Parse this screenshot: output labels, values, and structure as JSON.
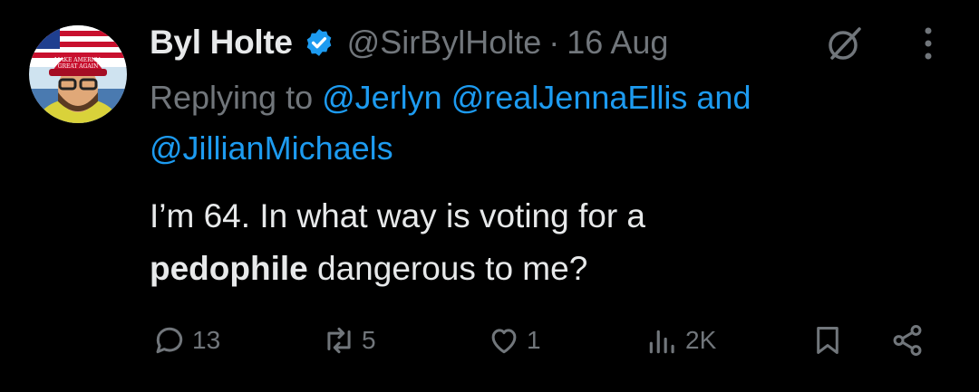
{
  "tweet": {
    "display_name": "Byl Holte",
    "handle": "@SirBylHolte",
    "separator": "·",
    "date": "16 Aug",
    "reply_prefix": "Replying to",
    "mentions": [
      "@Jerlyn",
      "@realJennaEllis",
      "@JillianMichaels"
    ],
    "mention_joiner": "and",
    "text_line1": "I’m 64. In what way is voting for a",
    "text_bold": "pedophile",
    "text_rest": "dangerous to me?",
    "avatar_hat_text": "MAKE AMERICA GREAT AGAIN"
  },
  "actions": {
    "replies": "13",
    "reposts": "5",
    "likes": "1",
    "views": "2K"
  },
  "icons": {
    "verified": "verified-badge-icon",
    "grok": "grok-icon",
    "more": "more-icon",
    "reply": "reply-icon",
    "repost": "repost-icon",
    "like": "heart-icon",
    "views": "views-chart-icon",
    "bookmark": "bookmark-icon",
    "share": "share-icon"
  },
  "colors": {
    "background": "#000000",
    "text": "#e7e9ea",
    "muted": "#71767b",
    "link": "#1d9bf0"
  }
}
